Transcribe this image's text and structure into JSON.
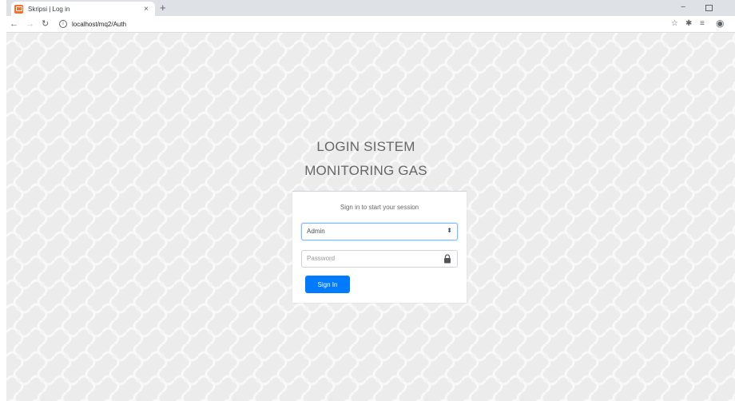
{
  "browser": {
    "tab_title": "Skripsi | Log in",
    "tab_close": "×",
    "new_tab": "+",
    "url": "localhost/mq2/Auth",
    "icons": {
      "back": "arrow-left",
      "forward": "arrow-right",
      "reload": "reload",
      "info": "info",
      "bookmark": "star",
      "extensions": "puzzle",
      "reading_list": "list",
      "profile": "account"
    }
  },
  "login": {
    "title_line1": "LOGIN SISTEM",
    "title_line2": "MONITORING GAS",
    "message": "Sign in to start your session",
    "user_select_value": "Admin",
    "password_placeholder": "Password",
    "sign_in_label": "Sign In"
  },
  "colors": {
    "primary": "#007bff",
    "background": "#ececec",
    "tab_favicon": "#f4702b"
  }
}
